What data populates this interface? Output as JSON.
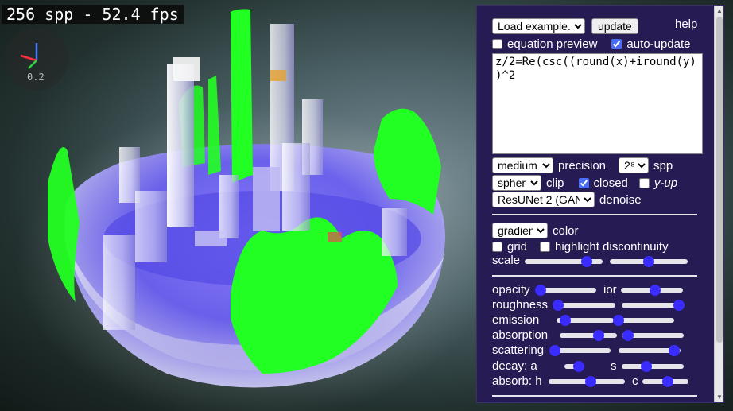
{
  "stats": {
    "text": "256 spp - 52.4 fps"
  },
  "axes": {
    "scale": "0.2"
  },
  "panel": {
    "example_select": "Load example...",
    "update_button": "update",
    "help_link": "help",
    "equation_preview": {
      "label": "equation preview",
      "checked": false
    },
    "auto_update": {
      "label": "auto-update",
      "checked": true
    },
    "equation": "z/2=Re(csc((round(x)+iround(y))^2",
    "precision": {
      "value": "medium",
      "label": "precision"
    },
    "spp": {
      "value": "2⁸",
      "label": "spp"
    },
    "clip": {
      "value": "sphere",
      "label": "clip"
    },
    "closed": {
      "label": "closed",
      "checked": true
    },
    "y_up": {
      "label": "y-up",
      "checked": false
    },
    "denoise": {
      "value": "ResUNet 2 (GAN)",
      "label": "denoise"
    },
    "color": {
      "value": "gradient",
      "label": "color"
    },
    "grid": {
      "label": "grid",
      "checked": false
    },
    "highlight": {
      "label": "highlight discontinuity",
      "checked": false
    },
    "scale_label": "scale",
    "sliders": {
      "scale_1": 0.8,
      "scale_2": 0.5,
      "opacity": 0.0,
      "ior": 0.55,
      "roughness": 0.0,
      "roughness_2": 1.0,
      "emission": 0.15,
      "emission_2": 0.0,
      "absorption": 0.68,
      "absorption_2": 0.1,
      "scattering": 0.0,
      "scattering_2": 0.9,
      "decay_a": 0.75,
      "decay_s": 0.4,
      "absorb_h": 0.55,
      "absorb_c": 0.55
    },
    "labels": {
      "opacity": "opacity",
      "ior": "ior",
      "roughness": "roughness",
      "emission": "emission",
      "absorption": "absorption",
      "scattering": "scattering",
      "decay_a": "decay: a",
      "decay_s": "s",
      "absorb_h": "absorb: h",
      "absorb_c": "c"
    }
  },
  "colors": {
    "panel_bg": "#261b52",
    "surface_green": "#22ff22",
    "glass_blue": "#6a5cff",
    "slider_thumb": "#3a2cff"
  }
}
